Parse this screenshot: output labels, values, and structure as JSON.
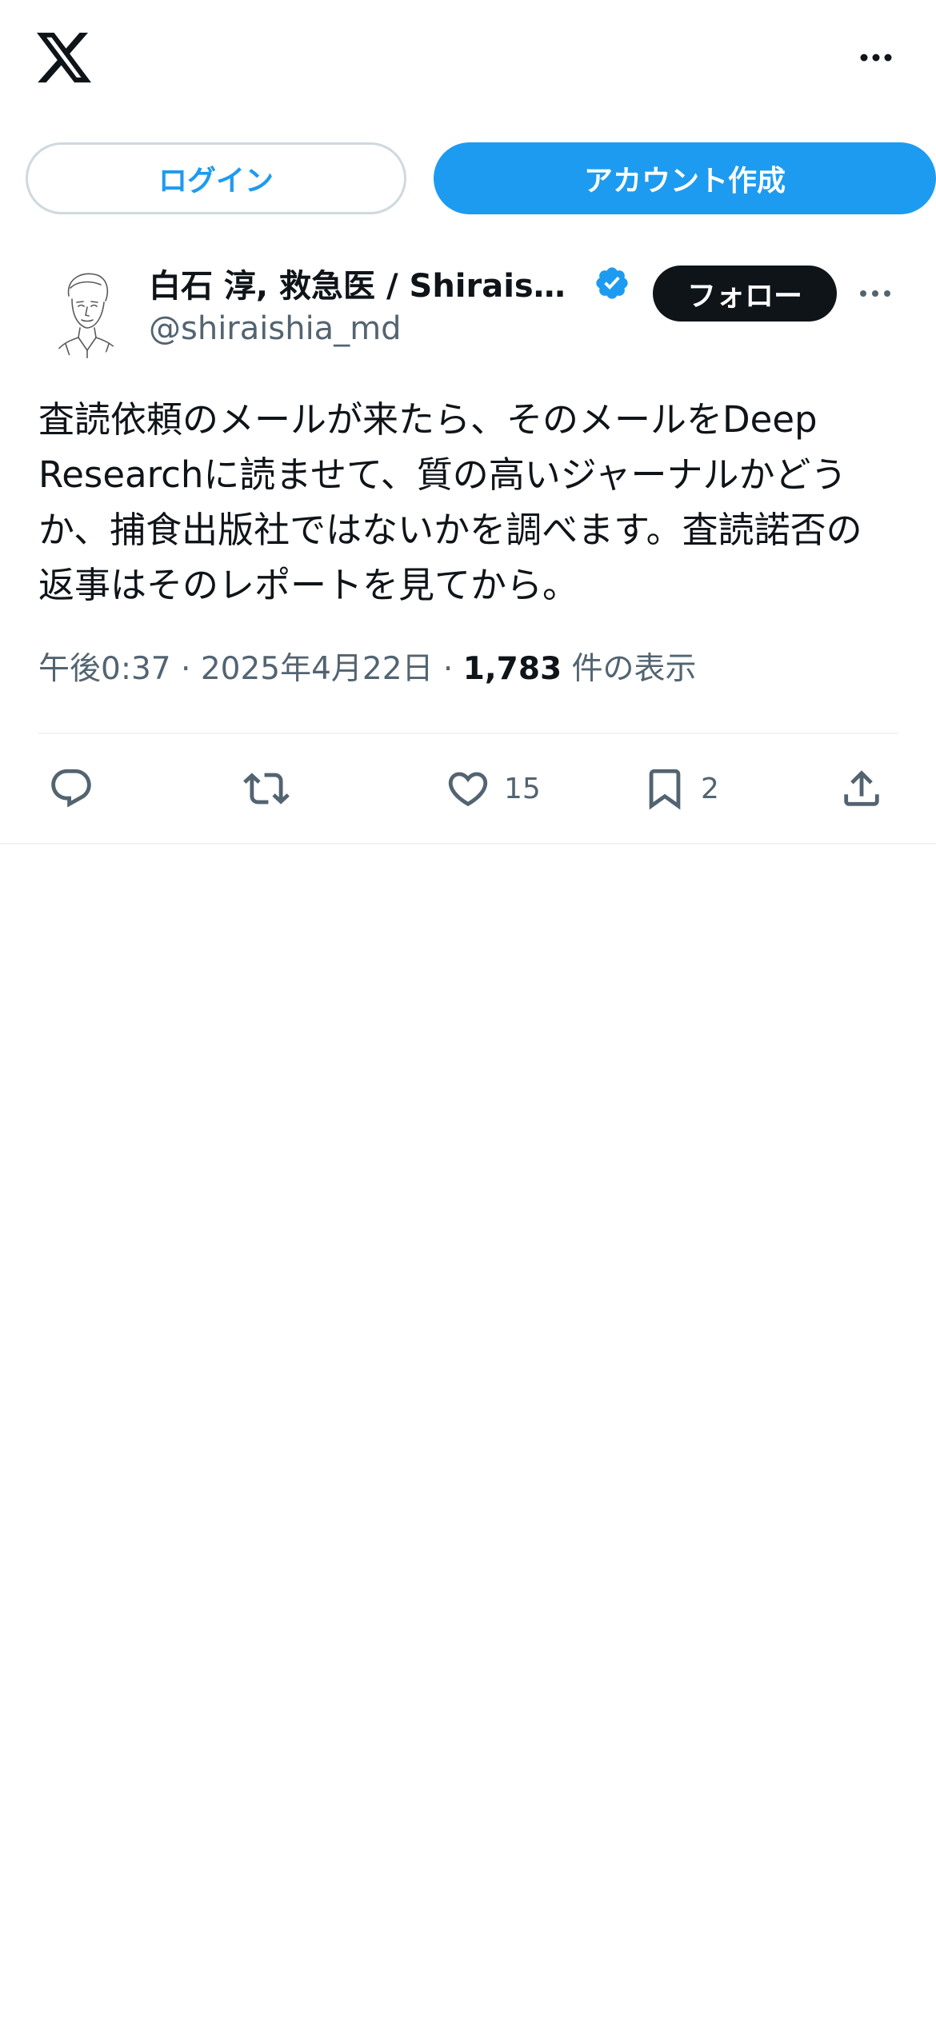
{
  "header": {
    "logo_icon": "x-logo-icon",
    "more_icon": "more-horizontal-icon"
  },
  "auth": {
    "login_label": "ログイン",
    "signup_label": "アカウント作成"
  },
  "tweet": {
    "author": {
      "display_name": "白石 淳, 救急医 / Shiraishi Atsushi",
      "handle": "@shiraishia_md",
      "verified": true,
      "avatar_icon": "sketch-portrait-avatar"
    },
    "follow_label": "フォロー",
    "text": "査読依頼のメールが来たら、そのメールをDeep Researchに読ませて、質の高いジャーナルかどうか、捕食出版社ではないかを調べます。査読諾否の返事はそのレポートを見てから。",
    "time": "午後0:37",
    "separator": "·",
    "date": "2025年4月22日",
    "views_count": "1,783",
    "views_label": "件の表示",
    "actions": {
      "reply_count": "",
      "retweet_count": "",
      "like_count": "15",
      "bookmark_count": "2"
    }
  },
  "colors": {
    "accent": "#1d9bf0",
    "text_primary": "#0f1419",
    "text_secondary": "#536471",
    "border": "#cfd9de"
  }
}
